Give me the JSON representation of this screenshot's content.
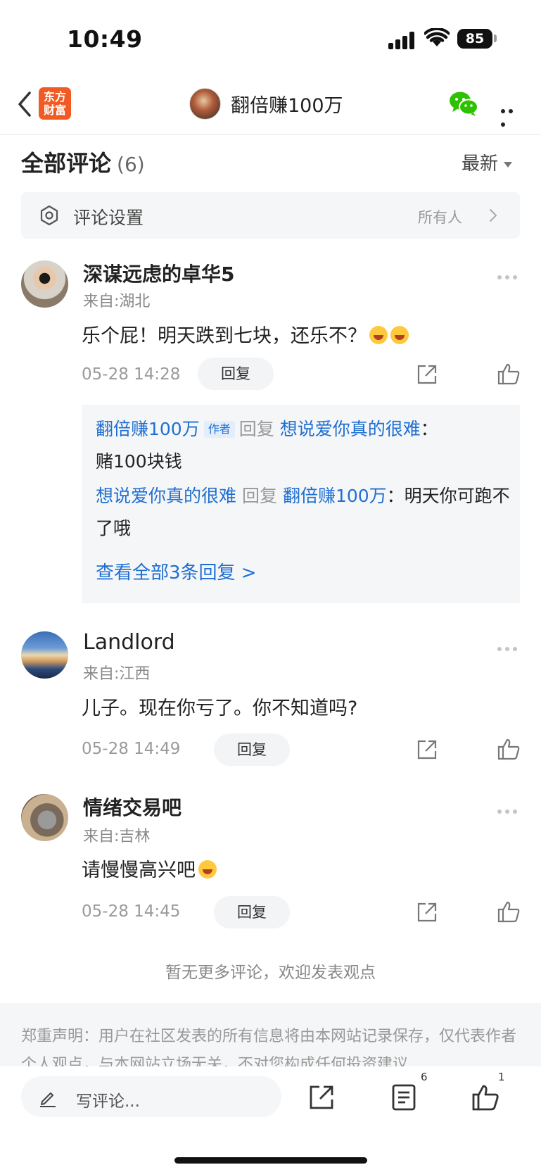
{
  "status_bar": {
    "time": "10:49",
    "battery": "85"
  },
  "nav": {
    "logo_line1": "东方",
    "logo_line2": "财富",
    "title": "翻倍赚100万"
  },
  "header": {
    "title": "全部评论",
    "count": "(6)",
    "sort_label": "最新"
  },
  "settings": {
    "label": "评论设置",
    "value": "所有人"
  },
  "comments": [
    {
      "username": "深谋远虑的卓华5",
      "location": "来自:湖北",
      "content": "乐个屁！明天跌到七块，还乐不？",
      "time": "05-28 14:28",
      "reply_label": "回复",
      "replies": [
        {
          "from": "翻倍赚100万",
          "tag": "作者",
          "verb": "回复",
          "to": "想说爱你真的很难",
          "sep": "：",
          "text": "赌100块钱"
        },
        {
          "from": "想说爱你真的很难",
          "verb": "回复",
          "to": "翻倍赚100万",
          "sep": "：",
          "text": "明天你可跑不了哦"
        }
      ],
      "view_all": "查看全部3条回复 >"
    },
    {
      "username": "Landlord",
      "location": "来自:江西",
      "content": "儿子。现在你亏了。你不知道吗?",
      "time": "05-28 14:49",
      "reply_label": "回复"
    },
    {
      "username": "情绪交易吧",
      "location": "来自:吉林",
      "content": "请慢慢高兴吧",
      "time": "05-28 14:45",
      "reply_label": "回复"
    }
  ],
  "footer": {
    "no_more": "暂无更多评论，欢迎发表观点",
    "disclaimer": "郑重声明：用户在社区发表的所有信息将由本网站记录保存，仅代表作者个人观点，与本网站立场无关，不对您构成任何投资建议"
  },
  "bottom_bar": {
    "input_placeholder": "写评论...",
    "comments_badge": "6",
    "likes_badge": "1"
  },
  "colors": {
    "brand": "#f15a22",
    "link": "#1f6fd1",
    "wechat": "#2dc100"
  }
}
